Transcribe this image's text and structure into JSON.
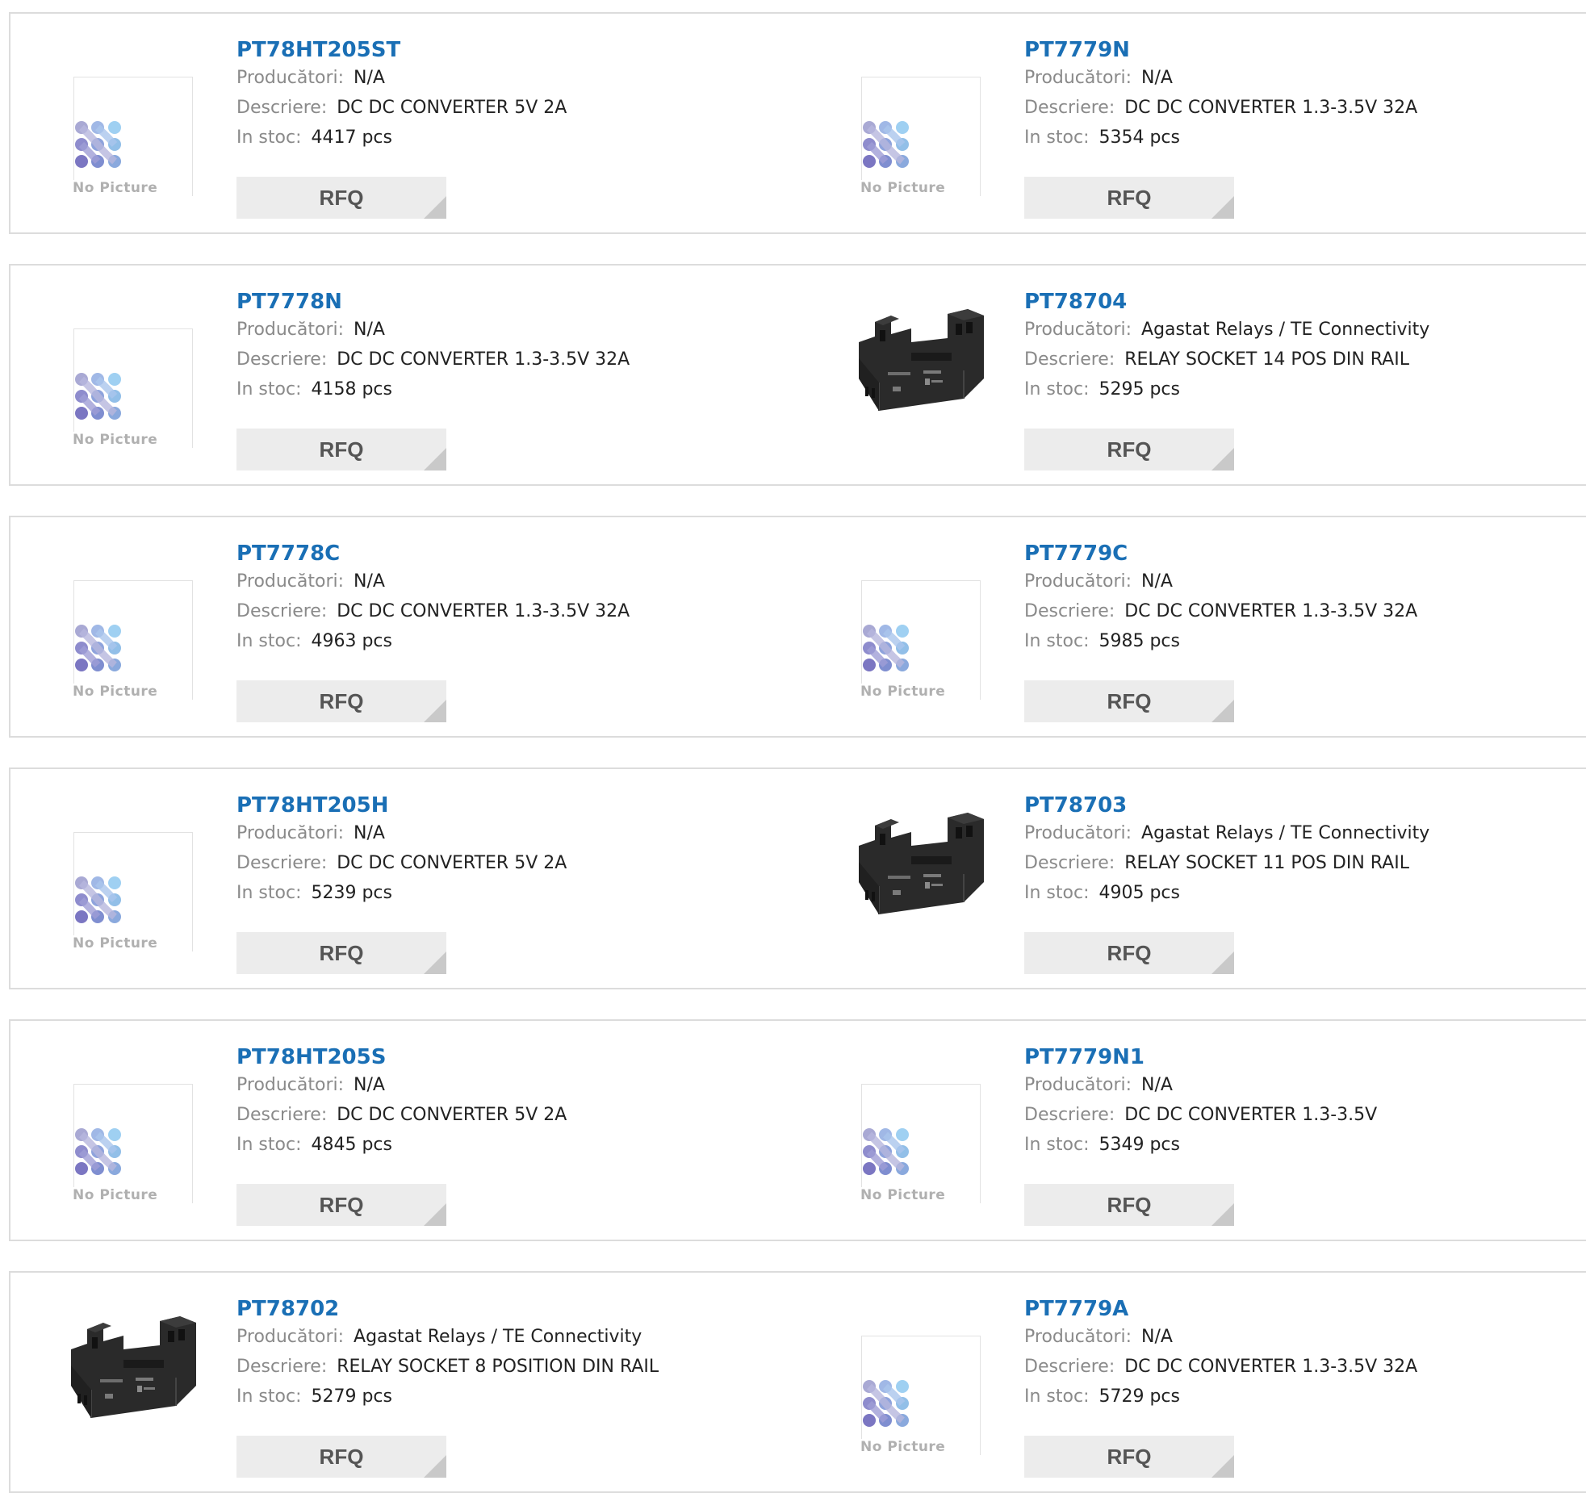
{
  "no_picture_label": "No Picture",
  "field_labels": {
    "manufacturer": "Producători:",
    "description": "Descriere:",
    "stock": "In stoc:"
  },
  "rfq_label": "RFQ",
  "colors": {
    "title": "#1a6fb5",
    "label": "#8a8a8a",
    "button_bg": "#ececec"
  },
  "products": [
    {
      "part": "PT78HT205ST",
      "manufacturer": "N/A",
      "description": "DC DC CONVERTER 5V 2A",
      "stock": "4417 pcs",
      "image": "no-picture"
    },
    {
      "part": "PT7779N",
      "manufacturer": "N/A",
      "description": "DC DC CONVERTER 1.3-3.5V 32A",
      "stock": "5354 pcs",
      "image": "no-picture"
    },
    {
      "part": "PT7778N",
      "manufacturer": "N/A",
      "description": "DC DC CONVERTER 1.3-3.5V 32A",
      "stock": "4158 pcs",
      "image": "no-picture"
    },
    {
      "part": "PT78704",
      "manufacturer": "Agastat Relays / TE Connectivity",
      "description": "RELAY SOCKET 14 POS DIN RAIL",
      "stock": "5295 pcs",
      "image": "relay-socket"
    },
    {
      "part": "PT7778C",
      "manufacturer": "N/A",
      "description": "DC DC CONVERTER 1.3-3.5V 32A",
      "stock": "4963 pcs",
      "image": "no-picture"
    },
    {
      "part": "PT7779C",
      "manufacturer": "N/A",
      "description": "DC DC CONVERTER 1.3-3.5V 32A",
      "stock": "5985 pcs",
      "image": "no-picture"
    },
    {
      "part": "PT78HT205H",
      "manufacturer": "N/A",
      "description": "DC DC CONVERTER 5V 2A",
      "stock": "5239 pcs",
      "image": "no-picture"
    },
    {
      "part": "PT78703",
      "manufacturer": "Agastat Relays / TE Connectivity",
      "description": "RELAY SOCKET 11 POS DIN RAIL",
      "stock": "4905 pcs",
      "image": "relay-socket"
    },
    {
      "part": "PT78HT205S",
      "manufacturer": "N/A",
      "description": "DC DC CONVERTER 5V 2A",
      "stock": "4845 pcs",
      "image": "no-picture"
    },
    {
      "part": "PT7779N1",
      "manufacturer": "N/A",
      "description": "DC DC CONVERTER 1.3-3.5V",
      "stock": "5349 pcs",
      "image": "no-picture"
    },
    {
      "part": "PT78702",
      "manufacturer": "Agastat Relays / TE Connectivity",
      "description": "RELAY SOCKET 8 POSITION DIN RAIL",
      "stock": "5279 pcs",
      "image": "relay-socket"
    },
    {
      "part": "PT7779A",
      "manufacturer": "N/A",
      "description": "DC DC CONVERTER 1.3-3.5V 32A",
      "stock": "5729 pcs",
      "image": "no-picture"
    }
  ]
}
